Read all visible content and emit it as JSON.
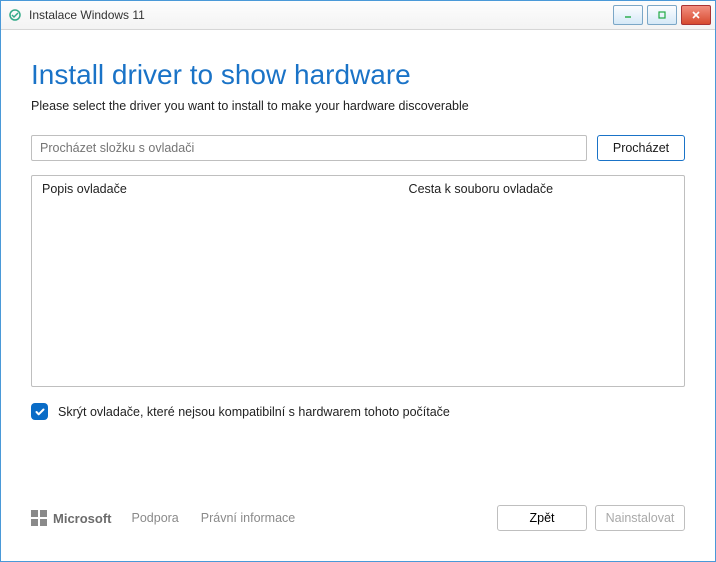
{
  "window": {
    "title": "Instalace Windows 11"
  },
  "main": {
    "heading": "Install driver to show hardware",
    "subheading": "Please select the driver you want to install to make your hardware discoverable"
  },
  "path": {
    "placeholder": "Procházet složku s ovladači",
    "browse_label": "Procházet"
  },
  "list": {
    "col1": "Popis ovladače",
    "col2": "Cesta k souboru ovladače"
  },
  "checkbox": {
    "checked": true,
    "label": "Skrýt ovladače, které nejsou kompatibilní s hardwarem tohoto počítače"
  },
  "footer": {
    "brand": "Microsoft",
    "support": "Podpora",
    "legal": "Právní informace",
    "back": "Zpět",
    "install": "Nainstalovat"
  }
}
